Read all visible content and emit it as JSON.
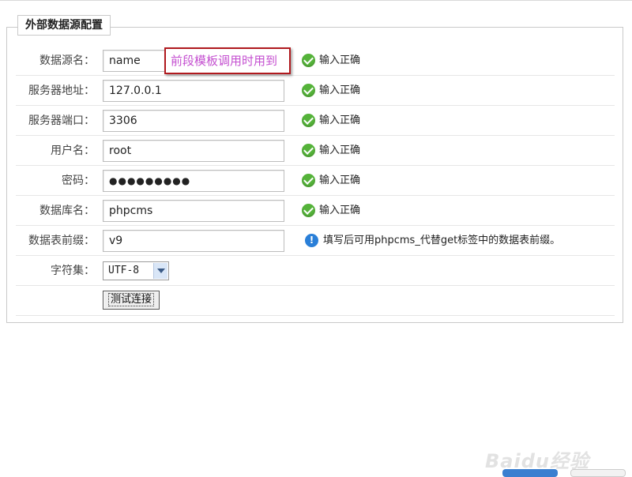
{
  "legend": "外部数据源配置",
  "rows": [
    {
      "label": "数据源名：",
      "value": "name",
      "status": "输入正确"
    },
    {
      "label": "服务器地址：",
      "value": "127.0.0.1",
      "status": "输入正确"
    },
    {
      "label": "服务器端口：",
      "value": "3306",
      "status": "输入正确"
    },
    {
      "label": "用户名：",
      "value": "root",
      "status": "输入正确"
    },
    {
      "label": "密码：",
      "value": "●●●●●●●●●",
      "status": "输入正确"
    },
    {
      "label": "数据库名：",
      "value": "phpcms",
      "status": "输入正确"
    },
    {
      "label": "数据表前缀：",
      "value": "v9",
      "hint": "填写后可用phpcms_代替get标签中的数据表前缀。"
    },
    {
      "label": "字符集：",
      "select_value": "UTF-8"
    }
  ],
  "annotation": "前段模板调用时用到",
  "test_button": "测试连接",
  "watermark": "Baidu经验",
  "colors": {
    "ok": "#55b33a",
    "info": "#2a7fd8",
    "annotation_border": "#b0191e",
    "annotation_text": "#c44fd0"
  }
}
